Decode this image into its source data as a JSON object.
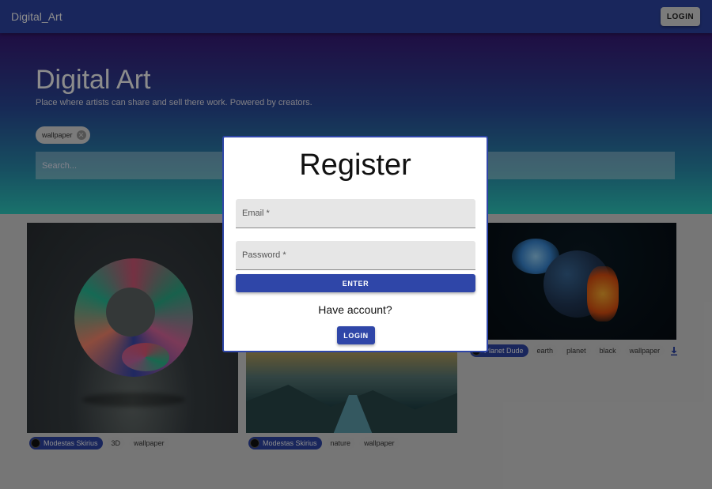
{
  "appbar": {
    "brand": "Digital_Art",
    "login_label": "LOGIN"
  },
  "hero": {
    "title": "Digital Art",
    "subtitle": "Place where artists can share and sell there work. Powered by creators.",
    "filter_chip": "wallpaper",
    "search_placeholder": "Search..."
  },
  "cards": [
    {
      "author": "Modestas Skirius",
      "tags": [
        "3D",
        "wallpaper"
      ]
    },
    {
      "author": "Modestas Skirius",
      "tags": [
        "nature",
        "wallpaper"
      ]
    },
    {
      "author": "Planet Dude",
      "tags": [
        "earth",
        "planet",
        "black",
        "wallpaper"
      ],
      "download_icon": "download-icon"
    }
  ],
  "modal": {
    "title": "Register",
    "email_label": "Email *",
    "password_label": "Password *",
    "enter_label": "ENTER",
    "have_account": "Have account?",
    "login_label": "LOGIN"
  },
  "colors": {
    "primary": "#2f46a8",
    "hero_top": "#3a1a7a",
    "hero_bottom": "#2fd0c4"
  }
}
